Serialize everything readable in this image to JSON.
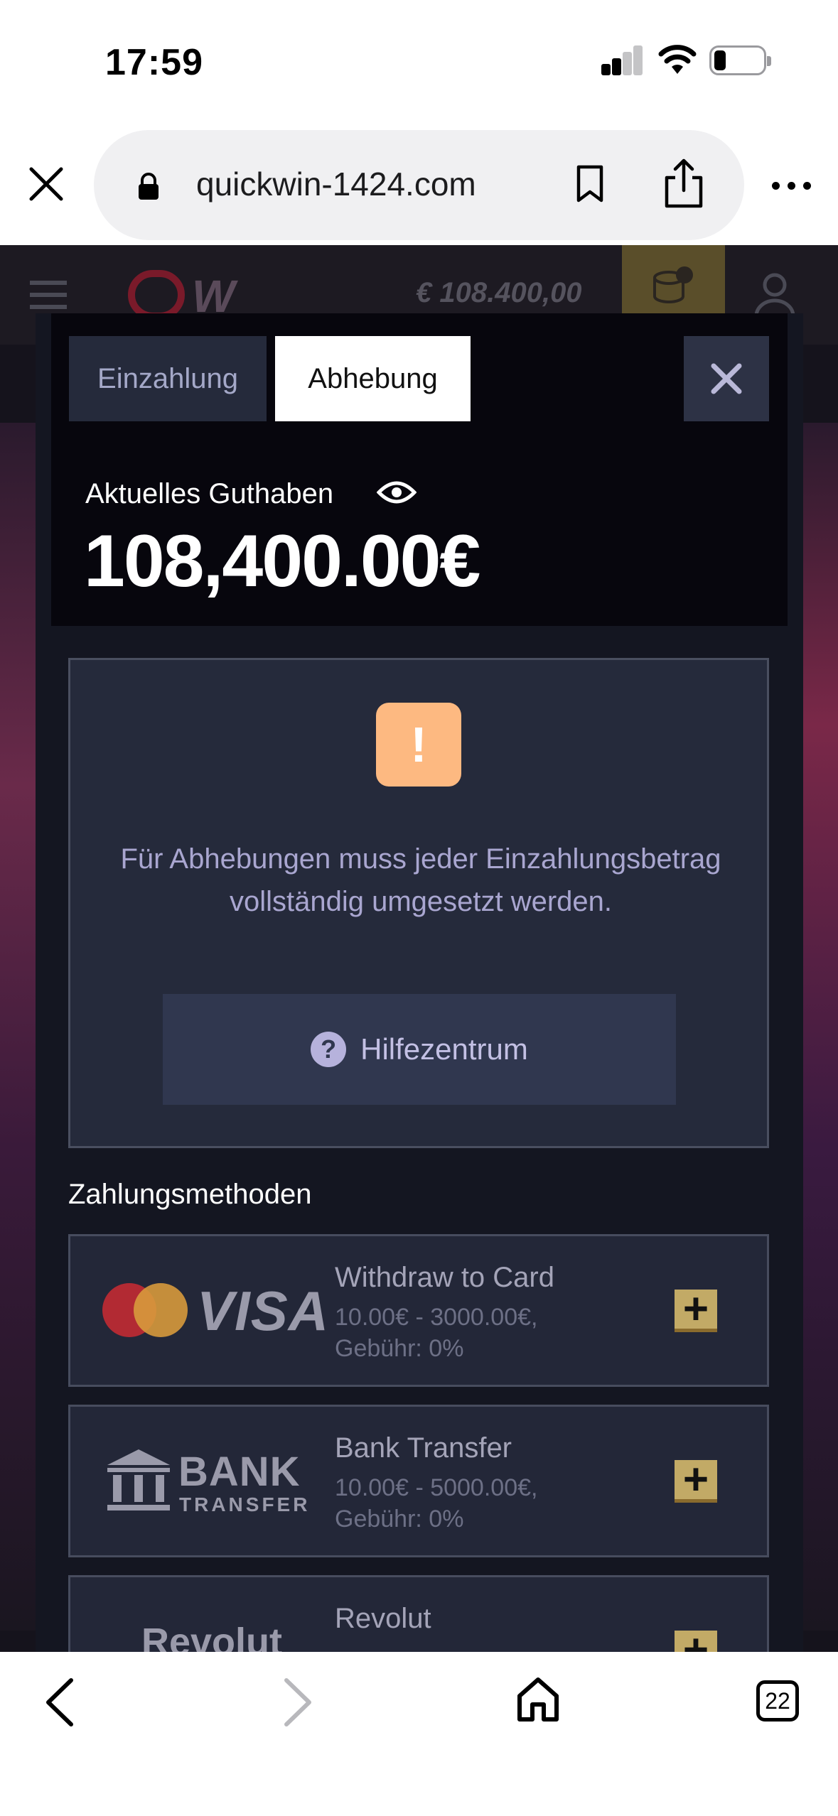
{
  "status_bar": {
    "time": "17:59"
  },
  "browser": {
    "url": "quickwin-1424.com",
    "tabs_count": "22"
  },
  "site_header": {
    "balance": "€ 108.400,00"
  },
  "modal": {
    "tabs": [
      {
        "label": "Einzahlung",
        "active": false
      },
      {
        "label": "Abhebung",
        "active": true
      }
    ],
    "balance_label": "Aktuelles Guthaben",
    "balance_value": "108,400.00€",
    "warning": {
      "icon": "!",
      "text": "Für Abhebungen muss jeder Einzahlungsbetrag vollständig umgesetzt werden.",
      "help_label": "Hilfezentrum"
    },
    "payment_heading": "Zahlungsmethoden",
    "payment_methods": [
      {
        "title": "Withdraw to Card",
        "range": "10.00€ - 3000.00€,",
        "fee": "Gebühr: 0%",
        "logo_text": "VISA"
      },
      {
        "title": "Bank Transfer",
        "range": "10.00€ - 5000.00€,",
        "fee": "Gebühr: 0%",
        "logo_text": "BANK",
        "logo_sub": "TRANSFER"
      },
      {
        "title": "Revolut",
        "range": "",
        "fee": "",
        "logo_text": "Revolut"
      }
    ]
  },
  "colors": {
    "warning": "#fdb981",
    "accent_plus": "#c2aa66",
    "modal_bg": "#141621"
  }
}
